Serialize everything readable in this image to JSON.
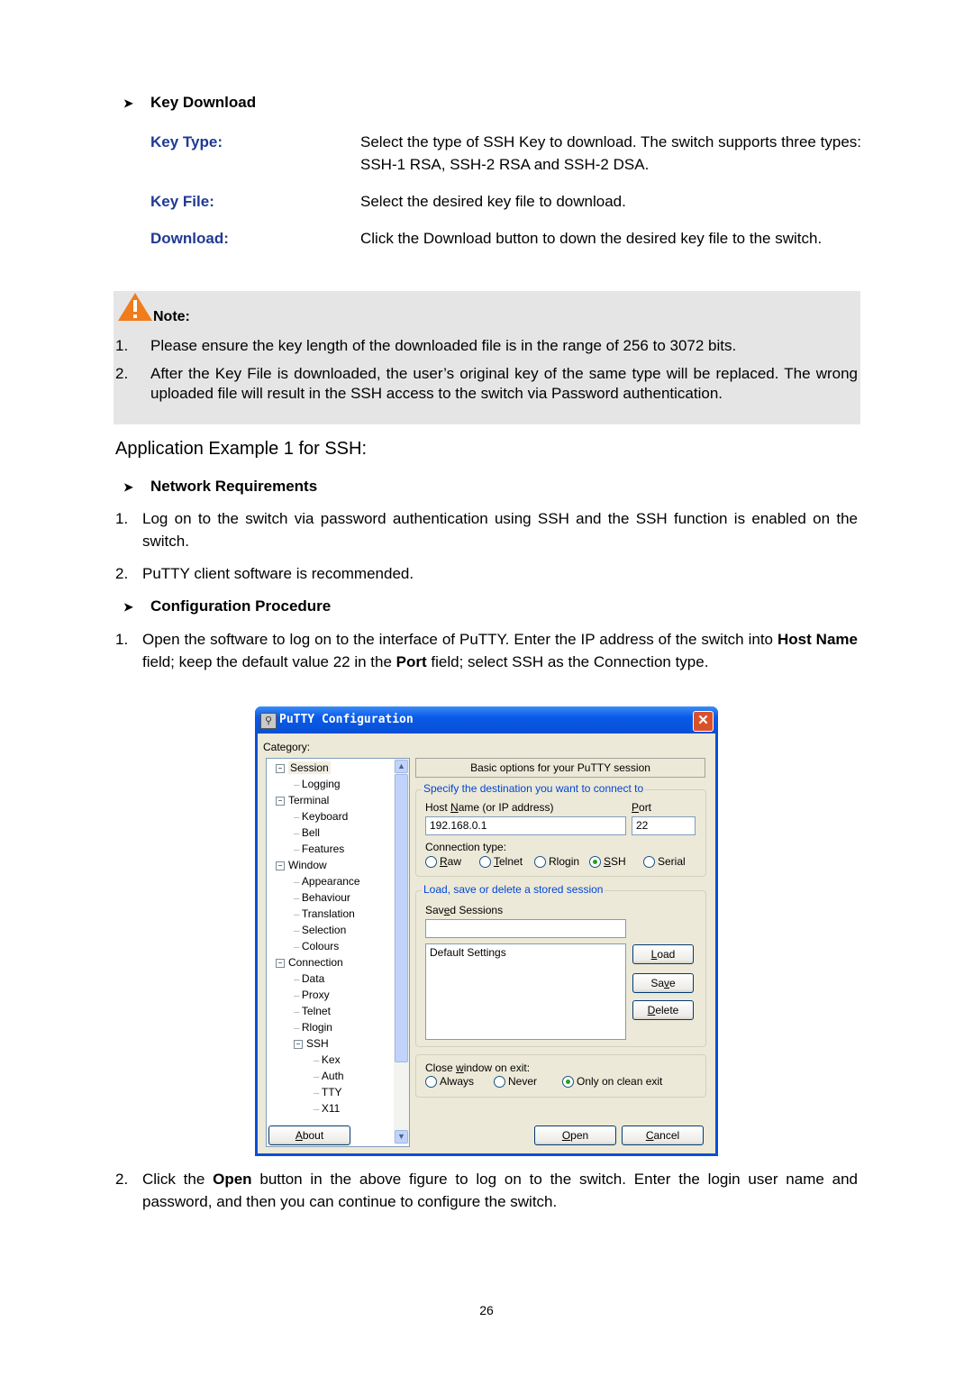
{
  "key_download": {
    "heading": "Key Download",
    "params": [
      {
        "name": "Key Type:",
        "desc": "Select the type of SSH Key to download. The switch supports three types: SSH-1 RSA, SSH-2 RSA and SSH-2 DSA."
      },
      {
        "name": "Key File:",
        "desc": "Select the desired key file to download."
      },
      {
        "name": "Download:",
        "desc": "Click the Download button to down the desired key file to the switch."
      }
    ]
  },
  "note": {
    "label": "Note:",
    "items": [
      "Please ensure the key length of the downloaded file is in the range of 256 to 3072 bits.",
      "After the Key File is downloaded, the user’s original key of the same type will be replaced. The wrong uploaded file will result in the SSH access to the switch via Password authentication."
    ]
  },
  "app_example": {
    "title": "Application Example 1 for SSH:",
    "network_requirements": {
      "heading": "Network Requirements",
      "items": [
        "Log on to the switch via password authentication using SSH and the SSH function is enabled on the switch.",
        "PuTTY client software is recommended."
      ]
    },
    "configuration_procedure": {
      "heading": "Configuration Procedure",
      "step1": {
        "a": "Open the software to log on to the interface of PuTTY. Enter the IP address of the switch into ",
        "b1": "Host Name",
        "c": " field; keep the default value 22 in the ",
        "b2": "Port",
        "d": " field; select SSH as the Connection type."
      },
      "step2": {
        "a": "Click the ",
        "b": "Open",
        "c": " button in the above figure to log on to the switch. Enter the login user name and password, and then you can continue to configure the switch."
      }
    }
  },
  "putty": {
    "title": "PuTTY Configuration",
    "category_label": "Category:",
    "tree": [
      {
        "label": "Session",
        "level": 0,
        "expanded": true,
        "selected": true
      },
      {
        "label": "Logging",
        "level": 1
      },
      {
        "label": "Terminal",
        "level": 0,
        "expanded": true
      },
      {
        "label": "Keyboard",
        "level": 1
      },
      {
        "label": "Bell",
        "level": 1
      },
      {
        "label": "Features",
        "level": 1
      },
      {
        "label": "Window",
        "level": 0,
        "expanded": true
      },
      {
        "label": "Appearance",
        "level": 1
      },
      {
        "label": "Behaviour",
        "level": 1
      },
      {
        "label": "Translation",
        "level": 1
      },
      {
        "label": "Selection",
        "level": 1
      },
      {
        "label": "Colours",
        "level": 1
      },
      {
        "label": "Connection",
        "level": 0,
        "expanded": true
      },
      {
        "label": "Data",
        "level": 1
      },
      {
        "label": "Proxy",
        "level": 1
      },
      {
        "label": "Telnet",
        "level": 1
      },
      {
        "label": "Rlogin",
        "level": 1
      },
      {
        "label": "SSH",
        "level": 1,
        "expanded": true
      },
      {
        "label": "Kex",
        "level": 2
      },
      {
        "label": "Auth",
        "level": 2
      },
      {
        "label": "TTY",
        "level": 2
      },
      {
        "label": "X11",
        "level": 2
      }
    ],
    "panel_header": "Basic options for your PuTTY session",
    "dest_group": "Specify the destination you want to connect to",
    "host_label": "Host Name (or IP address)",
    "host_value": "192.168.0.1",
    "port_label": "Port",
    "port_value": "22",
    "conn_type_label": "Connection type:",
    "conn_types": [
      "Raw",
      "Telnet",
      "Rlogin",
      "SSH",
      "Serial"
    ],
    "conn_type_selected": "SSH",
    "sessions_group": "Load, save or delete a stored session",
    "saved_sessions_label": "Saved Sessions",
    "saved_sessions_value": "",
    "sessions_list": [
      "Default Settings"
    ],
    "load_btn": "Load",
    "save_btn": "Save",
    "delete_btn": "Delete",
    "close_label": "Close window on exit:",
    "close_options": [
      "Always",
      "Never",
      "Only on clean exit"
    ],
    "close_selected": "Only on clean exit",
    "about_btn": "About",
    "open_btn": "Open",
    "cancel_btn": "Cancel"
  },
  "page_number": "26"
}
